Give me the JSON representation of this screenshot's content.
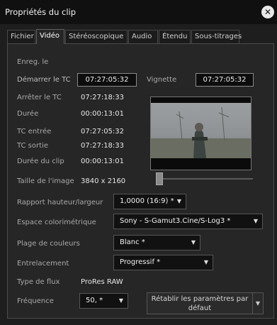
{
  "window": {
    "title": "Propriétés du clip"
  },
  "tabs": [
    {
      "label": "Fichier"
    },
    {
      "label": "Vidéo"
    },
    {
      "label": "Stéréoscopique"
    },
    {
      "label": "Audio"
    },
    {
      "label": "Étendu"
    },
    {
      "label": "Sous-titrages"
    }
  ],
  "video": {
    "enreg_label": "Enreg. le",
    "start_tc_label": "Démarrer le TC",
    "start_tc_value": "07:27:05:32",
    "vignette_label": "Vignette",
    "vignette_value": "07:27:05:32",
    "stop_tc_label": "Arrêter le TC",
    "stop_tc_value": "07:27:18:33",
    "duration_label": "Durée",
    "duration_value": "00:00:13:01",
    "tc_in_label": "TC entrée",
    "tc_in_value": "07:27:05:32",
    "tc_out_label": "TC sortie",
    "tc_out_value": "07:27:18:33",
    "clip_duration_label": "Durée du clip",
    "clip_duration_value": "00:00:13:01",
    "image_size_label": "Taille de l'image",
    "image_size_value": "3840 x 2160",
    "aspect_label": "Rapport hauteur/largeur",
    "aspect_value": "1,0000 (16:9) *",
    "colorspace_label": "Espace colorimétrique",
    "colorspace_value": "Sony - S-Gamut3.Cine/S-Log3 *",
    "color_range_label": "Plage de couleurs",
    "color_range_value": "Blanc *",
    "interlace_label": "Entrelacement",
    "interlace_value": "Progressif *",
    "stream_type_label": "Type de flux",
    "stream_type_value": "ProRes RAW",
    "frequency_label": "Fréquence",
    "frequency_value": "50, *",
    "reset_button": "Rétablir les paramètres par défaut"
  },
  "icons": {
    "close": "close-icon",
    "dropdown": "chevron-down-icon"
  },
  "colors": {
    "background": "#262626",
    "titlebar": "#101010",
    "field_border": "#8a8a8a"
  }
}
